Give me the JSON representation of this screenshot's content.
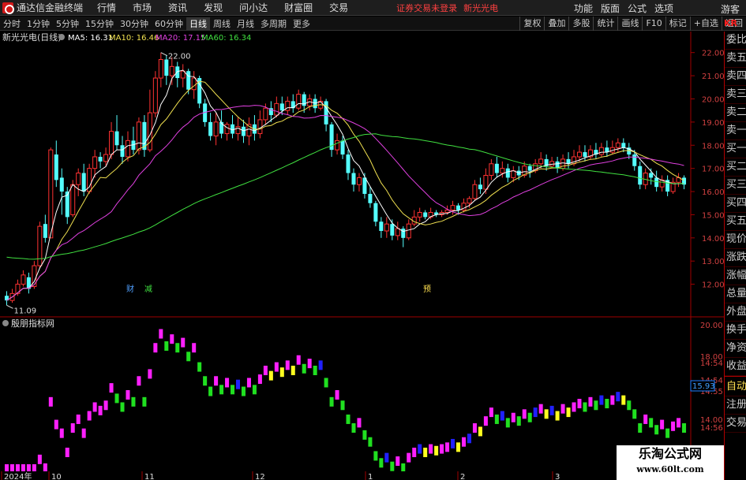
{
  "app": {
    "title": "通达信金融终端",
    "guest": "游客",
    "alert": "证券交易未登录",
    "stock_alert": "新光光电"
  },
  "menu": [
    "行情",
    "市场",
    "资讯",
    "发现",
    "问小达",
    "财富圈",
    "交易"
  ],
  "right_menu": [
    "功能",
    "版面",
    "公式",
    "选项"
  ],
  "periods": [
    "分时",
    "1分钟",
    "5分钟",
    "15分钟",
    "30分钟",
    "60分钟",
    "日线",
    "周线",
    "月线",
    "多周期",
    "更多"
  ],
  "active_period": "日线",
  "tb_buttons": [
    "复权",
    "叠加",
    "多股",
    "统计",
    "画线",
    "F10",
    "标记",
    "+自选",
    "返回"
  ],
  "side_top": "KR",
  "side_items": [
    "委比",
    "卖五",
    "卖四",
    "卖三",
    "卖二",
    "卖一",
    "买一",
    "买二",
    "买三",
    "买四",
    "买五",
    "现价",
    "涨跌",
    "涨幅",
    "总量",
    "外盘",
    "换手",
    "净资",
    "收益"
  ],
  "side_items2": [
    "自动",
    "注册",
    "交易"
  ],
  "main_chart": {
    "stock": "新光光电(日线)",
    "ma": [
      {
        "label": "MA5: 16.31",
        "color": "#ffffff"
      },
      {
        "label": "MA10: 16.46",
        "color": "#f0e050"
      },
      {
        "label": "MA20: 17.15",
        "color": "#e040e0"
      },
      {
        "label": "MA60: 16.34",
        "color": "#40e040"
      }
    ],
    "price_ticks": [
      "22.00",
      "21.00",
      "20.00",
      "19.00",
      "18.00",
      "17.00",
      "16.00",
      "15.00",
      "14.00",
      "13.00",
      "12.00"
    ],
    "high_label": "22.00",
    "low_label": "11.09",
    "markers": [
      "财",
      "减",
      "预"
    ]
  },
  "sub_chart": {
    "name": "殷朋指标网",
    "ticks": [
      "20.00",
      "18.00",
      "14:54",
      "14:54",
      "14:55",
      "14.00",
      "14:56"
    ],
    "current": "15.93"
  },
  "dates": [
    "2024年",
    "10",
    "11",
    "12",
    "1",
    "2",
    "3"
  ],
  "watermark": {
    "line1": "乐淘公式网",
    "line2": "www.60lt.com"
  },
  "colors": {
    "up": "#ff3232",
    "down": "#54ffff",
    "indicator": [
      "#ff20ff",
      "#2020ff",
      "#ffff20",
      "#20e020"
    ]
  },
  "chart_data": {
    "type": "candlestick",
    "title": "新光光电(日线)",
    "ylim": [
      11,
      22.5
    ],
    "candles": [
      {
        "o": 11.5,
        "c": 11.3,
        "h": 11.7,
        "l": 11.09
      },
      {
        "o": 11.3,
        "c": 11.6,
        "h": 11.8,
        "l": 11.2
      },
      {
        "o": 11.6,
        "c": 12.0,
        "h": 12.2,
        "l": 11.5
      },
      {
        "o": 12.0,
        "c": 12.4,
        "h": 12.6,
        "l": 11.9
      },
      {
        "o": 12.3,
        "c": 11.8,
        "h": 12.5,
        "l": 11.6
      },
      {
        "o": 11.9,
        "c": 12.8,
        "h": 13.0,
        "l": 11.8
      },
      {
        "o": 12.8,
        "c": 14.5,
        "h": 14.7,
        "l": 12.7
      },
      {
        "o": 14.6,
        "c": 14.0,
        "h": 15.0,
        "l": 13.8
      },
      {
        "o": 14.0,
        "c": 17.8,
        "h": 17.9,
        "l": 14.0
      },
      {
        "o": 17.6,
        "c": 16.5,
        "h": 18.2,
        "l": 16.2
      },
      {
        "o": 16.6,
        "c": 16.0,
        "h": 17.0,
        "l": 15.0
      },
      {
        "o": 16.0,
        "c": 14.9,
        "h": 16.2,
        "l": 14.6
      },
      {
        "o": 15.0,
        "c": 16.3,
        "h": 16.5,
        "l": 14.9
      },
      {
        "o": 16.3,
        "c": 16.8,
        "h": 17.0,
        "l": 15.8
      },
      {
        "o": 16.8,
        "c": 16.0,
        "h": 17.2,
        "l": 15.8
      },
      {
        "o": 16.0,
        "c": 17.0,
        "h": 17.2,
        "l": 15.9
      },
      {
        "o": 17.0,
        "c": 17.5,
        "h": 17.8,
        "l": 16.6
      },
      {
        "o": 17.5,
        "c": 17.3,
        "h": 17.7,
        "l": 17.0
      },
      {
        "o": 17.3,
        "c": 17.6,
        "h": 17.9,
        "l": 17.1
      },
      {
        "o": 17.6,
        "c": 18.6,
        "h": 19.0,
        "l": 17.4
      },
      {
        "o": 18.6,
        "c": 18.0,
        "h": 19.3,
        "l": 17.8
      },
      {
        "o": 18.0,
        "c": 17.5,
        "h": 18.4,
        "l": 17.2
      },
      {
        "o": 17.5,
        "c": 18.2,
        "h": 18.6,
        "l": 17.3
      },
      {
        "o": 18.2,
        "c": 17.8,
        "h": 18.8,
        "l": 17.6
      },
      {
        "o": 17.8,
        "c": 19.0,
        "h": 19.2,
        "l": 17.6
      },
      {
        "o": 19.0,
        "c": 17.8,
        "h": 19.3,
        "l": 17.5
      },
      {
        "o": 17.8,
        "c": 19.4,
        "h": 20.4,
        "l": 17.7
      },
      {
        "o": 19.4,
        "c": 20.9,
        "h": 21.2,
        "l": 19.2
      },
      {
        "o": 20.9,
        "c": 21.7,
        "h": 22.0,
        "l": 20.5
      },
      {
        "o": 21.7,
        "c": 21.0,
        "h": 21.9,
        "l": 20.6
      },
      {
        "o": 21.0,
        "c": 21.4,
        "h": 21.8,
        "l": 20.6
      },
      {
        "o": 21.4,
        "c": 20.9,
        "h": 21.6,
        "l": 20.5
      },
      {
        "o": 20.9,
        "c": 21.2,
        "h": 21.5,
        "l": 20.5
      },
      {
        "o": 21.2,
        "c": 20.4,
        "h": 21.3,
        "l": 20.2
      },
      {
        "o": 20.4,
        "c": 20.9,
        "h": 21.2,
        "l": 20.0
      },
      {
        "o": 20.9,
        "c": 19.8,
        "h": 21.0,
        "l": 19.6
      },
      {
        "o": 19.8,
        "c": 19.0,
        "h": 20.0,
        "l": 18.8
      },
      {
        "o": 19.0,
        "c": 18.4,
        "h": 19.4,
        "l": 18.2
      },
      {
        "o": 18.4,
        "c": 19.0,
        "h": 19.4,
        "l": 18.0
      },
      {
        "o": 19.0,
        "c": 18.5,
        "h": 19.5,
        "l": 18.3
      },
      {
        "o": 18.5,
        "c": 18.9,
        "h": 19.0,
        "l": 18.2
      },
      {
        "o": 18.9,
        "c": 18.5,
        "h": 19.3,
        "l": 18.3
      },
      {
        "o": 18.5,
        "c": 18.8,
        "h": 19.2,
        "l": 18.2
      },
      {
        "o": 18.8,
        "c": 18.4,
        "h": 19.1,
        "l": 18.1
      },
      {
        "o": 18.4,
        "c": 18.9,
        "h": 19.2,
        "l": 18.0
      },
      {
        "o": 18.9,
        "c": 18.5,
        "h": 19.3,
        "l": 18.2
      },
      {
        "o": 18.5,
        "c": 19.1,
        "h": 19.5,
        "l": 18.3
      },
      {
        "o": 19.1,
        "c": 19.6,
        "h": 19.8,
        "l": 18.9
      },
      {
        "o": 19.6,
        "c": 19.3,
        "h": 19.9,
        "l": 19.0
      },
      {
        "o": 19.3,
        "c": 19.8,
        "h": 20.1,
        "l": 19.2
      },
      {
        "o": 19.8,
        "c": 19.5,
        "h": 20.1,
        "l": 19.3
      },
      {
        "o": 19.5,
        "c": 19.9,
        "h": 20.1,
        "l": 19.3
      },
      {
        "o": 19.9,
        "c": 19.6,
        "h": 20.2,
        "l": 19.4
      },
      {
        "o": 19.6,
        "c": 20.2,
        "h": 20.4,
        "l": 19.5
      },
      {
        "o": 20.2,
        "c": 19.7,
        "h": 20.3,
        "l": 19.4
      },
      {
        "o": 19.7,
        "c": 20.0,
        "h": 20.2,
        "l": 19.5
      },
      {
        "o": 20.0,
        "c": 19.6,
        "h": 20.2,
        "l": 19.4
      },
      {
        "o": 19.6,
        "c": 19.9,
        "h": 20.1,
        "l": 19.5
      },
      {
        "o": 19.9,
        "c": 18.9,
        "h": 20.0,
        "l": 18.6
      },
      {
        "o": 18.9,
        "c": 17.8,
        "h": 19.0,
        "l": 17.5
      },
      {
        "o": 17.8,
        "c": 18.2,
        "h": 18.5,
        "l": 17.6
      },
      {
        "o": 18.2,
        "c": 17.6,
        "h": 18.4,
        "l": 17.4
      },
      {
        "o": 17.6,
        "c": 16.8,
        "h": 17.8,
        "l": 16.5
      },
      {
        "o": 16.8,
        "c": 16.3,
        "h": 17.0,
        "l": 16.0
      },
      {
        "o": 16.3,
        "c": 16.6,
        "h": 16.8,
        "l": 16.0
      },
      {
        "o": 16.6,
        "c": 15.9,
        "h": 16.8,
        "l": 15.7
      },
      {
        "o": 15.9,
        "c": 15.5,
        "h": 16.2,
        "l": 15.3
      },
      {
        "o": 15.5,
        "c": 14.7,
        "h": 15.6,
        "l": 14.5
      },
      {
        "o": 14.7,
        "c": 14.3,
        "h": 14.9,
        "l": 14.0
      },
      {
        "o": 14.3,
        "c": 14.6,
        "h": 14.9,
        "l": 14.0
      },
      {
        "o": 14.6,
        "c": 14.1,
        "h": 14.8,
        "l": 13.9
      },
      {
        "o": 14.1,
        "c": 14.4,
        "h": 14.7,
        "l": 13.9
      },
      {
        "o": 14.4,
        "c": 14.0,
        "h": 14.5,
        "l": 13.6
      },
      {
        "o": 14.0,
        "c": 14.6,
        "h": 14.8,
        "l": 13.9
      },
      {
        "o": 14.6,
        "c": 14.9,
        "h": 15.2,
        "l": 14.5
      },
      {
        "o": 14.9,
        "c": 15.1,
        "h": 15.3,
        "l": 14.7
      },
      {
        "o": 15.1,
        "c": 14.9,
        "h": 15.2,
        "l": 14.8
      },
      {
        "o": 14.9,
        "c": 15.1,
        "h": 15.3,
        "l": 14.8
      },
      {
        "o": 15.1,
        "c": 15.0,
        "h": 15.2,
        "l": 14.9
      },
      {
        "o": 15.0,
        "c": 15.1,
        "h": 15.2,
        "l": 14.9
      },
      {
        "o": 15.1,
        "c": 15.2,
        "h": 15.4,
        "l": 15.0
      },
      {
        "o": 15.2,
        "c": 15.4,
        "h": 15.6,
        "l": 15.0
      },
      {
        "o": 15.4,
        "c": 15.2,
        "h": 15.5,
        "l": 15.0
      },
      {
        "o": 15.2,
        "c": 15.5,
        "h": 15.7,
        "l": 15.1
      },
      {
        "o": 15.5,
        "c": 15.7,
        "h": 15.8,
        "l": 15.3
      },
      {
        "o": 15.7,
        "c": 16.3,
        "h": 16.5,
        "l": 15.6
      },
      {
        "o": 16.3,
        "c": 16.1,
        "h": 16.6,
        "l": 15.9
      },
      {
        "o": 16.1,
        "c": 16.7,
        "h": 17.0,
        "l": 15.9
      },
      {
        "o": 16.7,
        "c": 17.2,
        "h": 17.4,
        "l": 16.5
      },
      {
        "o": 17.2,
        "c": 16.8,
        "h": 17.5,
        "l": 16.6
      },
      {
        "o": 16.8,
        "c": 17.0,
        "h": 17.3,
        "l": 16.6
      },
      {
        "o": 17.0,
        "c": 16.6,
        "h": 17.2,
        "l": 16.4
      },
      {
        "o": 16.6,
        "c": 16.9,
        "h": 17.1,
        "l": 16.4
      },
      {
        "o": 16.9,
        "c": 16.7,
        "h": 17.1,
        "l": 16.5
      },
      {
        "o": 16.7,
        "c": 17.1,
        "h": 17.3,
        "l": 16.6
      },
      {
        "o": 17.1,
        "c": 16.9,
        "h": 17.2,
        "l": 16.6
      },
      {
        "o": 16.9,
        "c": 17.2,
        "h": 17.4,
        "l": 16.8
      },
      {
        "o": 17.2,
        "c": 17.4,
        "h": 17.7,
        "l": 17.0
      },
      {
        "o": 17.4,
        "c": 17.1,
        "h": 17.6,
        "l": 16.9
      },
      {
        "o": 17.1,
        "c": 17.3,
        "h": 17.5,
        "l": 17.0
      },
      {
        "o": 17.3,
        "c": 17.0,
        "h": 17.5,
        "l": 16.8
      },
      {
        "o": 17.0,
        "c": 17.4,
        "h": 17.6,
        "l": 16.9
      },
      {
        "o": 17.4,
        "c": 17.2,
        "h": 17.7,
        "l": 17.0
      },
      {
        "o": 17.2,
        "c": 17.5,
        "h": 17.8,
        "l": 17.1
      },
      {
        "o": 17.5,
        "c": 17.7,
        "h": 18.0,
        "l": 17.3
      },
      {
        "o": 17.7,
        "c": 17.5,
        "h": 18.0,
        "l": 17.3
      },
      {
        "o": 17.5,
        "c": 17.8,
        "h": 18.0,
        "l": 17.4
      },
      {
        "o": 17.8,
        "c": 17.6,
        "h": 18.1,
        "l": 17.4
      },
      {
        "o": 17.6,
        "c": 17.9,
        "h": 18.1,
        "l": 17.5
      },
      {
        "o": 17.9,
        "c": 17.7,
        "h": 18.2,
        "l": 17.5
      },
      {
        "o": 17.7,
        "c": 17.9,
        "h": 18.2,
        "l": 17.6
      },
      {
        "o": 17.9,
        "c": 18.1,
        "h": 18.3,
        "l": 17.7
      },
      {
        "o": 18.1,
        "c": 17.9,
        "h": 18.3,
        "l": 17.7
      },
      {
        "o": 17.9,
        "c": 17.6,
        "h": 18.1,
        "l": 17.4
      },
      {
        "o": 17.6,
        "c": 17.1,
        "h": 17.8,
        "l": 16.9
      },
      {
        "o": 17.1,
        "c": 16.3,
        "h": 17.3,
        "l": 16.1
      },
      {
        "o": 16.3,
        "c": 16.8,
        "h": 17.0,
        "l": 16.1
      },
      {
        "o": 16.8,
        "c": 16.6,
        "h": 17.0,
        "l": 16.3
      },
      {
        "o": 16.6,
        "c": 16.2,
        "h": 16.9,
        "l": 16.0
      },
      {
        "o": 16.2,
        "c": 16.5,
        "h": 16.7,
        "l": 16.0
      },
      {
        "o": 16.5,
        "c": 16.0,
        "h": 16.7,
        "l": 15.8
      },
      {
        "o": 16.0,
        "c": 16.4,
        "h": 16.6,
        "l": 15.9
      },
      {
        "o": 16.4,
        "c": 16.6,
        "h": 16.8,
        "l": 16.2
      },
      {
        "o": 16.6,
        "c": 16.3,
        "h": 16.7,
        "l": 16.1
      }
    ]
  }
}
